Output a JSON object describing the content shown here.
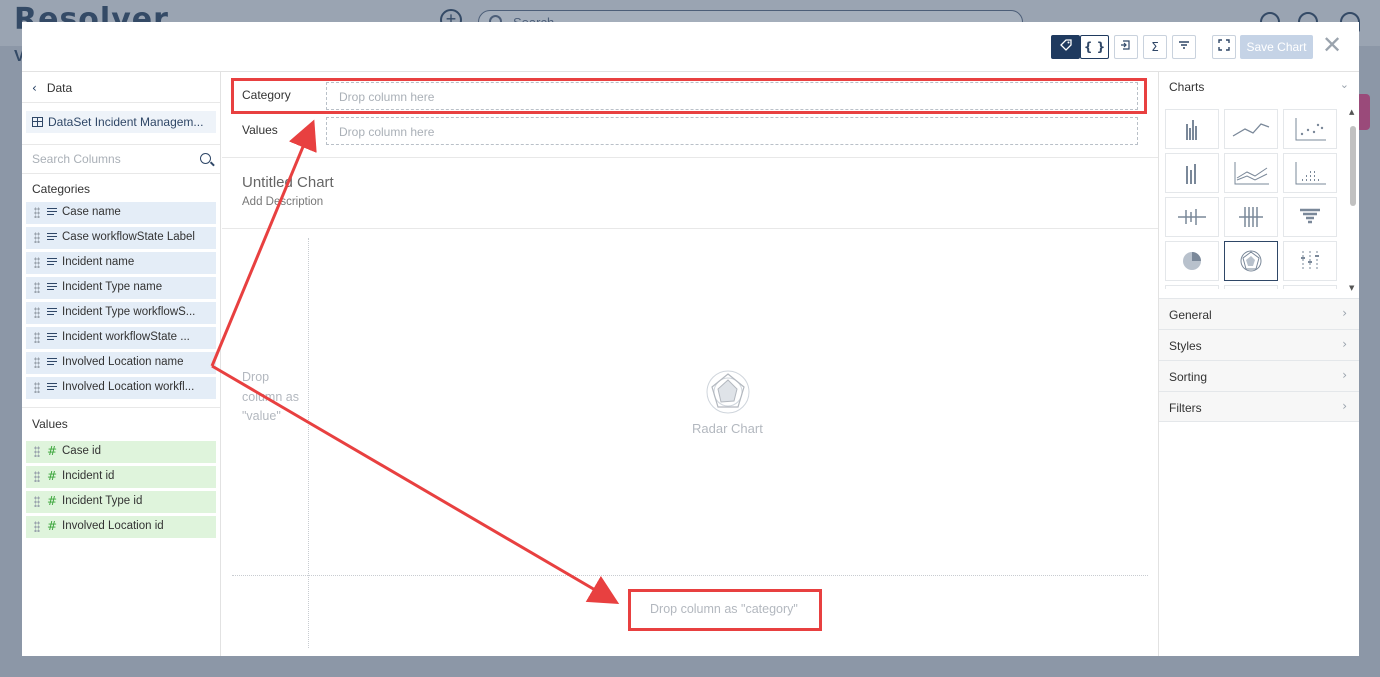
{
  "backdrop": {
    "logo": "Resolver",
    "search_placeholder": "Search",
    "side_letter": "V"
  },
  "toolbar": {
    "tag_icon": "tag-icon",
    "braces_label": "{ }",
    "sigma_label": "Σ",
    "save_label": "Save Chart",
    "close_label": "✕"
  },
  "left": {
    "back_label": "Data",
    "dataset_label": "DataSet Incident Managem...",
    "search_placeholder": "Search Columns",
    "categories_heading": "Categories",
    "categories": [
      "Case name",
      "Case workflowState Label",
      "Incident name",
      "Incident Type name",
      "Incident Type workflowS...",
      "Incident workflowState ...",
      "Involved Location name",
      "Involved Location workfl..."
    ],
    "values_heading": "Values",
    "values": [
      "Case id",
      "Incident id",
      "Incident Type id",
      "Involved Location id"
    ]
  },
  "center": {
    "category_label": "Category",
    "category_drop": "Drop column here",
    "values_label": "Values",
    "values_drop": "Drop column here",
    "chart_title": "Untitled Chart",
    "chart_desc": "Add Description",
    "drop_value_text": "Drop column as \"value\"",
    "chart_type_label": "Radar Chart",
    "drop_category_text": "Drop column as \"category\""
  },
  "right": {
    "charts_heading": "Charts",
    "chart_types": [
      "bar-chart-icon",
      "line-chart-icon",
      "scatter-chart-icon",
      "stacked-bar-icon",
      "multi-line-icon",
      "dot-matrix-icon",
      "horizontal-bar-icon",
      "stacked-horizontal-icon",
      "funnel-icon",
      "pie-chart-icon",
      "radar-chart-icon",
      "box-plot-icon"
    ],
    "selected_chart": "radar-chart-icon",
    "sections": [
      "General",
      "Styles",
      "Sorting",
      "Filters"
    ]
  },
  "colors": {
    "annotation": "#e84040",
    "primary": "#1f3a5f",
    "category_bg": "#e4edf7",
    "value_bg": "#dff4dc"
  }
}
